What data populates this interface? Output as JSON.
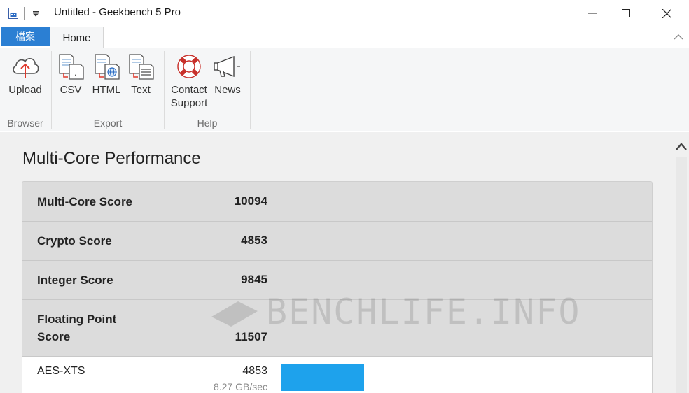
{
  "window": {
    "title": "Untitled - Geekbench 5 Pro",
    "minimize_icon": "minimize-icon",
    "maximize_icon": "maximize-icon",
    "close_icon": "close-icon"
  },
  "ribbon_tabs": {
    "file": "檔案",
    "home": "Home"
  },
  "ribbon": {
    "groups": [
      {
        "label": "Browser",
        "buttons": [
          {
            "label": "Upload",
            "icon": "cloud-upload-icon"
          }
        ]
      },
      {
        "label": "Export",
        "buttons": [
          {
            "label": "CSV",
            "icon": "csv-export-icon"
          },
          {
            "label": "HTML",
            "icon": "html-export-icon"
          },
          {
            "label": "Text",
            "icon": "text-export-icon"
          }
        ]
      },
      {
        "label": "Help",
        "buttons": [
          {
            "label": "Contact Support",
            "line1": "Contact",
            "line2": "Support",
            "icon": "lifebuoy-icon"
          },
          {
            "label": "News",
            "icon": "megaphone-icon"
          }
        ]
      }
    ]
  },
  "main": {
    "title": "Multi-Core Performance",
    "scores": [
      {
        "name": "Multi-Core Score",
        "value": "10094"
      },
      {
        "name": "Crypto Score",
        "value": "4853"
      },
      {
        "name": "Integer Score",
        "value": "9845"
      },
      {
        "name": "Floating Point Score",
        "line1": "Floating Point",
        "line2": "Score",
        "value": "11507"
      }
    ],
    "workloads": [
      {
        "name": "AES-XTS",
        "value": "4853",
        "rate": "8.27 GB/sec",
        "bar_fraction": 0.42
      }
    ],
    "watermark": "BENCHLIFE.INFO"
  },
  "colors": {
    "accent": "#2b7fd3",
    "bar": "#1ea2ec",
    "ribbon_bg": "#f5f6f7",
    "content_bg": "#f0f0f0"
  }
}
